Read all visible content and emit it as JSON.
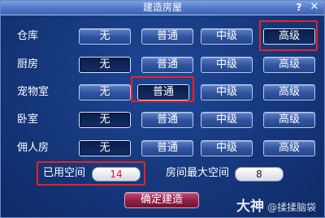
{
  "window": {
    "title": "建造房屋",
    "help_label": "?",
    "close_label": "✕"
  },
  "rows": [
    {
      "label": "仓库",
      "options": [
        "无",
        "普通",
        "中级",
        "高级"
      ],
      "selected": "高级"
    },
    {
      "label": "厨房",
      "options": [
        "无",
        "普通",
        "中级",
        "高级"
      ],
      "selected": "无"
    },
    {
      "label": "宠物室",
      "options": [
        "无",
        "普通",
        "中级",
        "高级"
      ],
      "selected": "普通"
    },
    {
      "label": "卧室",
      "options": [
        "无",
        "普通",
        "中级",
        "高级"
      ],
      "selected": "无"
    },
    {
      "label": "佣人房",
      "options": [
        "无",
        "普通",
        "中级",
        "高级"
      ],
      "selected": "无"
    }
  ],
  "space": {
    "used_label": "已用空间",
    "used_value": "14",
    "max_label": "房间最大空间",
    "max_value": "8"
  },
  "confirm_label": "确定建造",
  "watermark": {
    "big": "大神",
    "small": "@揉揉脑袋"
  },
  "colors": {
    "highlight": "#e8231f",
    "used_value": "#e31b1b",
    "confirm": "#8e1f46"
  }
}
